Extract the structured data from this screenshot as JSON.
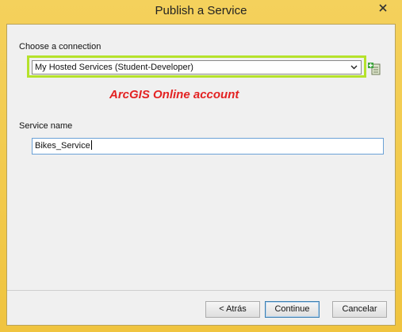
{
  "window": {
    "title": "Publish a Service"
  },
  "connection": {
    "label": "Choose a connection",
    "selected": "My Hosted Services (Student-Developer)"
  },
  "annotation": {
    "text": "ArcGIS Online account",
    "color": "#e32222",
    "highlight_color": "#b5e22b"
  },
  "service": {
    "label": "Service name",
    "value": "Bikes_Service"
  },
  "buttons": {
    "back": "< Atrás",
    "continue": "Continue",
    "cancel": "Cancelar"
  },
  "icons": {
    "close": "close-icon",
    "dropdown": "chevron-down-icon",
    "add_connection": "add-connection-icon"
  }
}
